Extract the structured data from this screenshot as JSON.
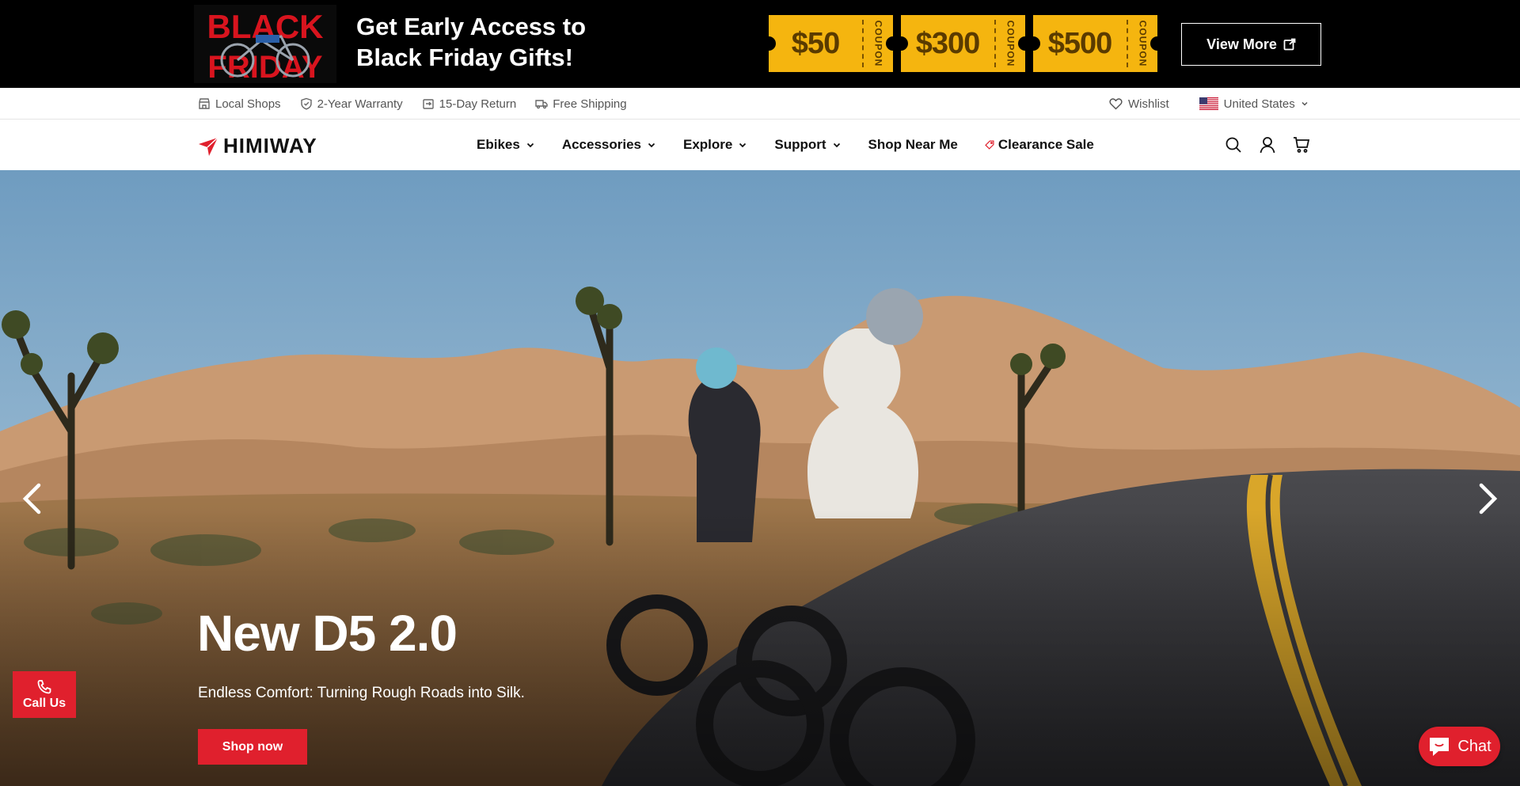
{
  "promo": {
    "heading_line1": "Get Early Access to",
    "heading_line2": "Black Friday Gifts!",
    "art_text_top": "BLACK",
    "art_text_bottom": "FRIDAY",
    "coupons": [
      {
        "amount": "$50",
        "label": "COUPON"
      },
      {
        "amount": "$300",
        "label": "COUPON"
      },
      {
        "amount": "$500",
        "label": "COUPON"
      }
    ],
    "view_more_label": "View More",
    "coupon_color": "#f5b50f"
  },
  "utility": {
    "items": [
      {
        "label": "Local Shops",
        "icon": "store-icon"
      },
      {
        "label": "2-Year Warranty",
        "icon": "shield-check-icon"
      },
      {
        "label": "15-Day Return",
        "icon": "return-icon"
      },
      {
        "label": "Free Shipping",
        "icon": "truck-icon"
      }
    ],
    "wishlist_label": "Wishlist",
    "country_label": "United States"
  },
  "nav": {
    "logo_text": "HIMIWAY",
    "menu": [
      {
        "label": "Ebikes",
        "dropdown": true
      },
      {
        "label": "Accessories",
        "dropdown": true
      },
      {
        "label": "Explore",
        "dropdown": true
      },
      {
        "label": "Support",
        "dropdown": true
      },
      {
        "label": "Shop Near Me",
        "dropdown": false
      },
      {
        "label": "Clearance Sale",
        "dropdown": false,
        "icon": "tag-icon"
      }
    ],
    "accent_color": "#e0202d"
  },
  "hero": {
    "title": "New D5 2.0",
    "subtitle": "Endless Comfort: Turning Rough Roads into Silk.",
    "cta_label": "Shop now"
  },
  "floating": {
    "call_us_label": "Call Us",
    "chat_label": "Chat"
  }
}
